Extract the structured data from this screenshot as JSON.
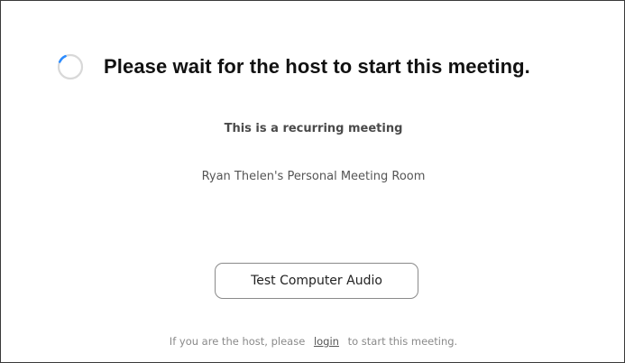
{
  "headline": {
    "icon": "loading-spinner-icon",
    "text": "Please wait for the host to start this meeting."
  },
  "meeting": {
    "recurring_label": "This is a recurring meeting",
    "room_name": "Ryan Thelen's Personal Meeting Room"
  },
  "buttons": {
    "test_audio_label": "Test Computer Audio"
  },
  "footer": {
    "prefix": "If you are the host, please",
    "login_link": "login",
    "suffix": "to start this meeting."
  },
  "colors": {
    "spinner_ring": "#d8d8d8",
    "spinner_accent": "#2d8cff"
  }
}
